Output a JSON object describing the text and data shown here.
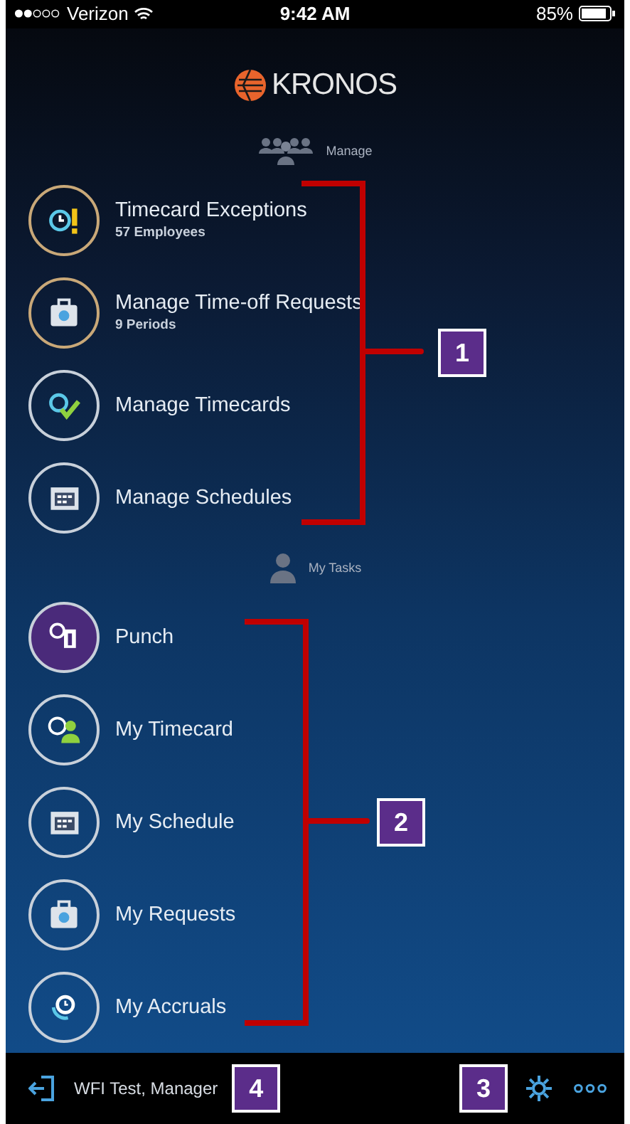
{
  "status_bar": {
    "carrier": "Verizon",
    "time": "9:42 AM",
    "battery": "85%"
  },
  "logo": {
    "text": "KRONOS"
  },
  "manage": {
    "heading": "Manage",
    "items": [
      {
        "title": "Timecard Exceptions",
        "subtitle": "57 Employees",
        "alert": true
      },
      {
        "title": "Manage Time-off Requests",
        "subtitle": "9 Periods",
        "alert": true
      },
      {
        "title": "Manage Timecards",
        "alert": false
      },
      {
        "title": "Manage Schedules",
        "alert": false
      }
    ]
  },
  "my_tasks": {
    "heading": "My Tasks",
    "items": [
      {
        "title": "Punch",
        "selected": true
      },
      {
        "title": "My Timecard",
        "selected": false
      },
      {
        "title": "My Schedule",
        "selected": false
      },
      {
        "title": "My Requests",
        "selected": false
      },
      {
        "title": "My Accruals",
        "selected": false
      }
    ]
  },
  "bottom_bar": {
    "user": "WFI Test, Manager"
  },
  "callouts": [
    {
      "number": "1"
    },
    {
      "number": "2"
    },
    {
      "number": "3"
    },
    {
      "number": "4"
    }
  ]
}
